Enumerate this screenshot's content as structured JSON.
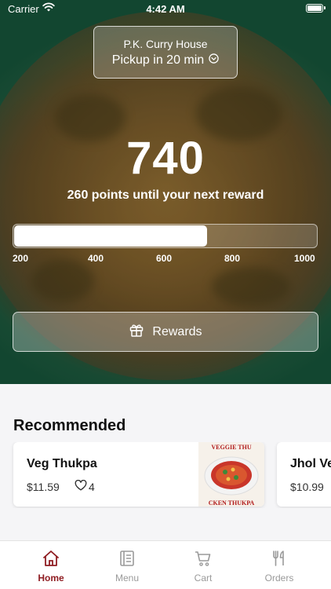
{
  "status_bar": {
    "carrier": "Carrier",
    "time": "4:42 AM"
  },
  "store": {
    "name": "P.K. Curry House",
    "pickup": "Pickup in 20 min"
  },
  "rewards": {
    "points": "740",
    "points_until_next": "260 points until your next reward",
    "progress_fraction": 0.64,
    "tick_labels": [
      "200",
      "400",
      "600",
      "800",
      "1000"
    ],
    "button_label": "Rewards"
  },
  "recommended": {
    "title": "Recommended",
    "items": [
      {
        "name": "Veg Thukpa",
        "price": "$11.59",
        "likes": "4",
        "image_text_top": "VEGGIE THU",
        "image_text_bottom": "CKEN THUKPA"
      },
      {
        "name": "Jhol Ve",
        "price": "$10.99"
      }
    ]
  },
  "tabs": [
    {
      "label": "Home",
      "icon": "home-icon",
      "active": true
    },
    {
      "label": "Menu",
      "icon": "menu-icon",
      "active": false
    },
    {
      "label": "Cart",
      "icon": "cart-icon",
      "active": false
    },
    {
      "label": "Orders",
      "icon": "utensils-icon",
      "active": false
    }
  ],
  "colors": {
    "accent": "#8f1d22",
    "hero_green": "#17563b",
    "inactive_tab": "#9a9a9a"
  }
}
